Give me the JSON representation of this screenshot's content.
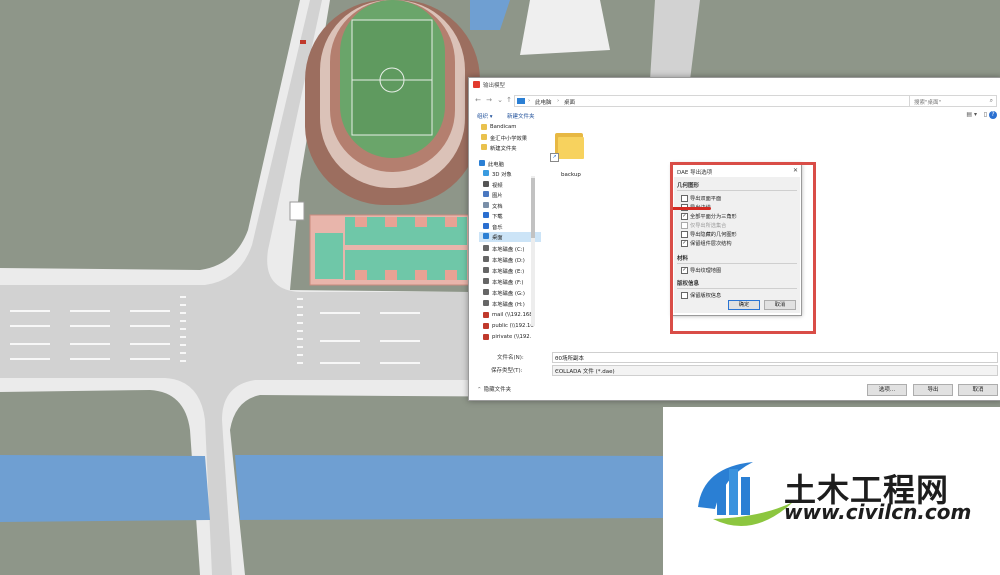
{
  "dialog": {
    "title": "输出模型",
    "breadcrumb": [
      "此电脑",
      "桌面"
    ],
    "search_placeholder": "搜索\"桌面\"",
    "organize_label": "组织 ▾",
    "new_folder_label": "新建文件夹",
    "nav_items": [
      {
        "label": "Bandicam",
        "icon": "folder-icon",
        "color": "#e9c14e"
      },
      {
        "label": "金汇中小学效果",
        "icon": "folder-icon",
        "color": "#e9c14e"
      },
      {
        "label": "新建文件夹",
        "icon": "folder-icon",
        "color": "#e9c14e"
      },
      {
        "label": "此电脑",
        "icon": "pc-icon",
        "color": "#2b7fd4"
      },
      {
        "label": "3D 对象",
        "icon": "cube-icon",
        "color": "#3a9be0"
      },
      {
        "label": "视频",
        "icon": "video-icon",
        "color": "#555555"
      },
      {
        "label": "图片",
        "icon": "picture-icon",
        "color": "#4a78c0"
      },
      {
        "label": "文档",
        "icon": "document-icon",
        "color": "#7a8fa8"
      },
      {
        "label": "下载",
        "icon": "download-icon",
        "color": "#2a6fd0"
      },
      {
        "label": "音乐",
        "icon": "music-icon",
        "color": "#2a6fd0"
      },
      {
        "label": "桌面",
        "icon": "desktop-icon",
        "color": "#2b7fd4",
        "selected": true
      },
      {
        "label": "本地磁盘 (C:)",
        "icon": "drive-icon",
        "color": "#666666"
      },
      {
        "label": "本地磁盘 (D:)",
        "icon": "drive-icon",
        "color": "#666666"
      },
      {
        "label": "本地磁盘 (E:)",
        "icon": "drive-icon",
        "color": "#666666"
      },
      {
        "label": "本地磁盘 (F:)",
        "icon": "drive-icon",
        "color": "#666666"
      },
      {
        "label": "本地磁盘 (G:)",
        "icon": "drive-icon",
        "color": "#666666"
      },
      {
        "label": "本地磁盘 (H:)",
        "icon": "drive-icon",
        "color": "#666666"
      },
      {
        "label": "mail (\\\\192.168",
        "icon": "network-drive-icon",
        "color": "#c0392b"
      },
      {
        "label": "public (\\\\192.16",
        "icon": "network-drive-icon",
        "color": "#c0392b"
      },
      {
        "label": "pirivate (\\\\192.",
        "icon": "network-drive-icon",
        "color": "#c0392b"
      }
    ],
    "file_item": "backup",
    "filename_label": "文件名(N):",
    "filename_value": "00场所副本",
    "filetype_label": "保存类型(T):",
    "filetype_value": "COLLADA 文件 (*.dae)",
    "options_button": "选项...",
    "export_button": "导出",
    "cancel_button": "取消",
    "hide_folders": "隐藏文件夹"
  },
  "options": {
    "title": "DAE 导出选项",
    "geometry_header": "几何图形",
    "items": [
      {
        "label": "导出双面平面",
        "checked": false,
        "disabled": false
      },
      {
        "label": "导出边线",
        "checked": false,
        "disabled": false
      },
      {
        "label": "全部平面分为三角形",
        "checked": true,
        "disabled": false
      },
      {
        "label": "仅导出所选集合",
        "checked": false,
        "disabled": true
      },
      {
        "label": "导出隐藏的几何图形",
        "checked": false,
        "disabled": false
      },
      {
        "label": "保留组件层次结构",
        "checked": true,
        "disabled": false
      }
    ],
    "material_header": "材料",
    "material_items": [
      {
        "label": "导出纹理地图",
        "checked": true,
        "disabled": false
      }
    ],
    "credits_header": "版权信息",
    "credits_items": [
      {
        "label": "保留版权信息",
        "checked": false,
        "disabled": false
      }
    ],
    "ok_button": "确定",
    "cancel_button": "取消"
  },
  "watermark": {
    "brand": "土木工程网",
    "url": "www.civilcn.com"
  }
}
